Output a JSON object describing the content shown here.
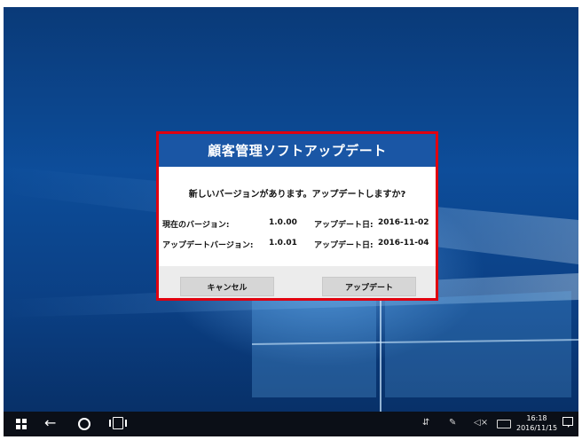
{
  "dialog": {
    "title": "顧客管理ソフトアップデート",
    "message": "新しいバージョンがあります。アップデートしますか?",
    "current": {
      "label": "現在のバージョン:",
      "version": "1.0.00",
      "date_label": "アップデート日:",
      "date": "2016-11-02"
    },
    "update": {
      "label": "アップデートバージョン:",
      "version": "1.0.01",
      "date_label": "アップデート日:",
      "date": "2016-11-04"
    },
    "cancel_label": "キャンセル",
    "update_label": "アップデート"
  },
  "taskbar": {
    "icons": [
      "windows-start-icon",
      "back-arrow-icon",
      "search-circle-icon",
      "task-view-icon"
    ],
    "back_glyph": "←",
    "tray": {
      "network_glyph": "⇵",
      "pen_glyph": "✎",
      "volume_glyph": "◁×",
      "time": "16:18",
      "date": "2016/11/15"
    }
  },
  "colors": {
    "dialog_header": "#1a56a5",
    "highlight_border": "#e0000f",
    "taskbar": "#0b0f17"
  }
}
